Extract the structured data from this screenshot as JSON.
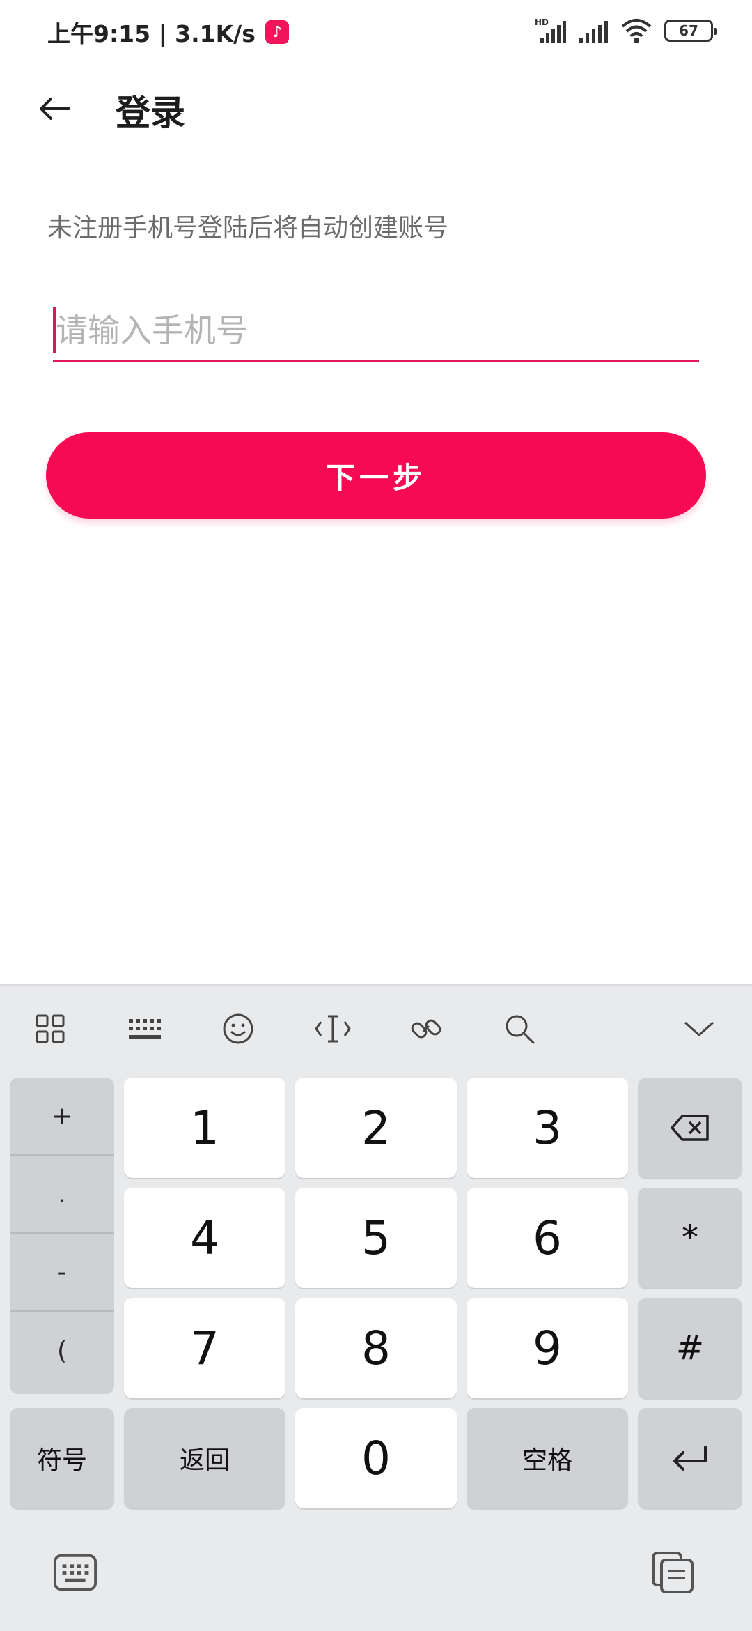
{
  "status_bar": {
    "time_speed": "上午9:15 | 3.1K/s",
    "app_badge": "♪",
    "network_label": "HD",
    "battery_level": "67"
  },
  "header": {
    "title": "登录"
  },
  "hint_text": "未注册手机号登陆后将自动创建账号",
  "phone_input": {
    "placeholder": "请输入手机号",
    "value": ""
  },
  "next_button_label": "下一步",
  "colors": {
    "accent": "#f70a54",
    "underline": "#e0155a"
  },
  "keyboard": {
    "toolbar_icons": [
      "grid-icon",
      "keyboard-layout-icon",
      "emoji-icon",
      "cursor-move-icon",
      "link-icon",
      "search-icon",
      "collapse-chevron-icon"
    ],
    "side_symbols": [
      "+",
      ".",
      "-",
      "("
    ],
    "digits": [
      "1",
      "2",
      "3",
      "4",
      "5",
      "6",
      "7",
      "8",
      "9",
      "0"
    ],
    "star": "*",
    "hash": "#",
    "symbols_label": "符号",
    "back_label": "返回",
    "space_label": "空格"
  }
}
